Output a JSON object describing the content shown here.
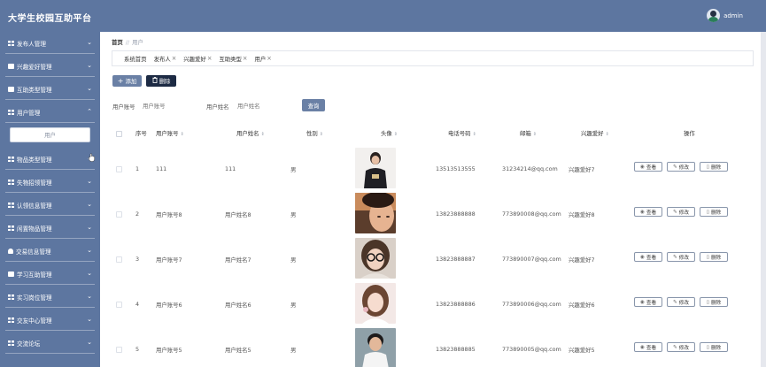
{
  "app": {
    "title": "大学生校园互助平台",
    "user_name": "admin"
  },
  "sidebar": {
    "items": [
      {
        "label": "发布人管理",
        "icon": "grid-icon",
        "expanded": false
      },
      {
        "label": "兴趣爱好管理",
        "icon": "box-icon",
        "expanded": false
      },
      {
        "label": "互助类型管理",
        "icon": "box-icon",
        "expanded": false
      },
      {
        "label": "用户管理",
        "icon": "grid-icon",
        "expanded": true,
        "sub": "用户"
      },
      {
        "label": "物品类型管理",
        "icon": "grid-icon",
        "expanded": false
      },
      {
        "label": "失物招领管理",
        "icon": "grid-icon",
        "expanded": false
      },
      {
        "label": "认领信息管理",
        "icon": "grid-icon",
        "expanded": false
      },
      {
        "label": "闲置物品管理",
        "icon": "grid-icon",
        "expanded": false
      },
      {
        "label": "交易信息管理",
        "icon": "person-icon",
        "expanded": false
      },
      {
        "label": "学习互助管理",
        "icon": "box-icon",
        "expanded": false
      },
      {
        "label": "实习岗位管理",
        "icon": "grid-icon",
        "expanded": false
      },
      {
        "label": "交友中心管理",
        "icon": "grid-icon",
        "expanded": false
      },
      {
        "label": "交流论坛",
        "icon": "grid-icon",
        "expanded": false
      }
    ]
  },
  "breadcrumb": {
    "home": "首页",
    "sep": "//",
    "current": "用户"
  },
  "tags": [
    {
      "label": "系统首页",
      "closable": false
    },
    {
      "label": "发布人",
      "closable": true
    },
    {
      "label": "兴趣爱好",
      "closable": true
    },
    {
      "label": "互助类型",
      "closable": true
    },
    {
      "label": "用户",
      "closable": true
    }
  ],
  "toolbar": {
    "add_label": "添加",
    "delete_label": "删除",
    "add_icon": "+",
    "delete_icon": "🗑"
  },
  "search": {
    "account_label": "用户账号",
    "account_placeholder": "用户账号",
    "name_label": "用户姓名",
    "name_placeholder": "用户姓名",
    "button_label": "查询"
  },
  "table": {
    "headers": {
      "index": "序号",
      "account": "用户账号",
      "name": "用户姓名",
      "gender": "性别",
      "avatar": "头像",
      "phone": "电话号码",
      "email": "邮箱",
      "hobby": "兴趣爱好",
      "ops": "操作"
    },
    "op_labels": {
      "view": "查看",
      "edit": "修改",
      "delete": "删除"
    },
    "rows": [
      {
        "index": "1",
        "account": "111",
        "name": "111",
        "gender": "男",
        "phone": "13513513555",
        "email": "31234214@qq.com",
        "hobby": "兴趣爱好7"
      },
      {
        "index": "2",
        "account": "用户账号8",
        "name": "用户姓名8",
        "gender": "男",
        "phone": "13823888888",
        "email": "773890008@qq.com",
        "hobby": "兴趣爱好8"
      },
      {
        "index": "3",
        "account": "用户账号7",
        "name": "用户姓名7",
        "gender": "男",
        "phone": "13823888887",
        "email": "773890007@qq.com",
        "hobby": "兴趣爱好7"
      },
      {
        "index": "4",
        "account": "用户账号6",
        "name": "用户姓名6",
        "gender": "男",
        "phone": "13823888886",
        "email": "773890006@qq.com",
        "hobby": "兴趣爱好6"
      },
      {
        "index": "5",
        "account": "用户账号5",
        "name": "用户姓名5",
        "gender": "男",
        "phone": "13823888885",
        "email": "773890005@qq.com",
        "hobby": "兴趣爱好5"
      }
    ]
  },
  "colors": {
    "brand": "#5d76a0",
    "dark_button": "#1d2b44",
    "button": "#6a80a5"
  }
}
